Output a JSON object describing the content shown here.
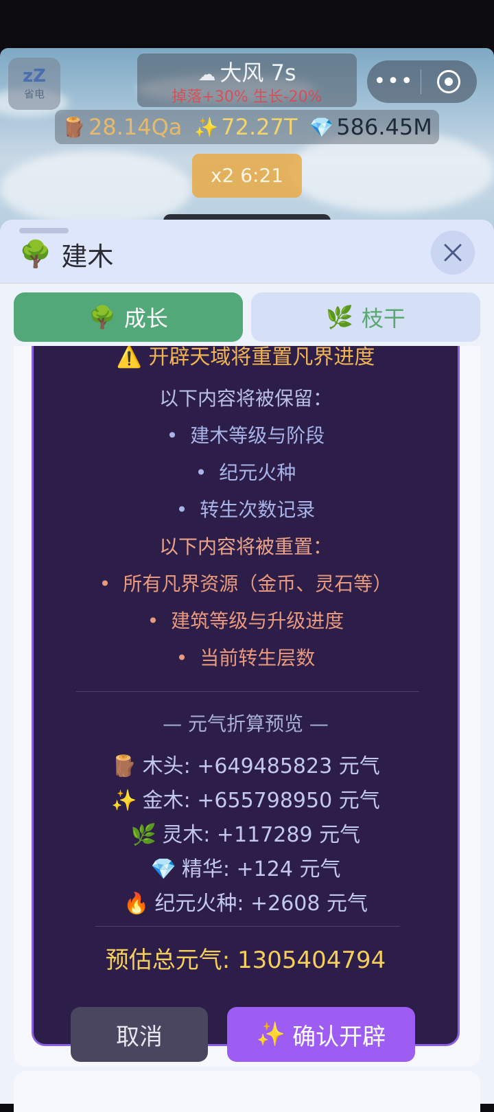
{
  "top_overlay": {
    "power_saver": {
      "icon": "zzz",
      "label": "省电"
    },
    "weather": {
      "icon": "wind-cloud",
      "title": "大风 7s",
      "effect": "掉落+30% 生长-20%"
    },
    "capsule": {
      "more_icon": "more-dots",
      "target_icon": "record-target"
    },
    "resources": {
      "wood": {
        "icon": "🪵",
        "value": "28.14Qa"
      },
      "gold": {
        "icon": "✨",
        "value": "72.27T"
      },
      "gem": {
        "icon": "💎",
        "value": "586.45M"
      }
    },
    "boost": "x2 6:21"
  },
  "panel": {
    "title_icon": "🌳",
    "title": "建木",
    "close_icon": "close-x",
    "tabs": [
      {
        "icon": "🌳",
        "label": "成长",
        "active": true
      },
      {
        "icon": "🌿",
        "label": "枝干",
        "active": false
      }
    ]
  },
  "dialog": {
    "warning": "⚠️ 开辟天域将重置凡界进度",
    "keep_title": "以下内容将被保留：",
    "keep_items": [
      "建木等级与阶段",
      "纪元火种",
      "转生次数记录"
    ],
    "reset_title": "以下内容将被重置：",
    "reset_items": [
      "所有凡界资源（金币、灵石等）",
      "建筑等级与升级进度",
      "当前转生层数"
    ],
    "preview_title": "— 元气折算预览 —",
    "conversions": [
      {
        "icon": "🪵",
        "text": "木头: +649485823 元气"
      },
      {
        "icon": "✨",
        "text": "金木: +655798950 元气"
      },
      {
        "icon": "🌿",
        "text": "灵木: +117289 元气"
      },
      {
        "icon": "💎",
        "text": "精华: +124 元气"
      },
      {
        "icon": "🔥",
        "text": "纪元火种: +2608 元气"
      }
    ],
    "total": "预估总元气: 1305404794",
    "cancel_label": "取消",
    "confirm_icon": "✨",
    "confirm_label": "确认开辟"
  },
  "colors": {
    "dialog_bg": "#2c1e48",
    "dialog_border": "#8a5fe0",
    "confirm_button": "#9d5cf2",
    "active_tab": "#52a878",
    "warning_text": "#f1b455",
    "total_text": "#f5cf5e"
  }
}
